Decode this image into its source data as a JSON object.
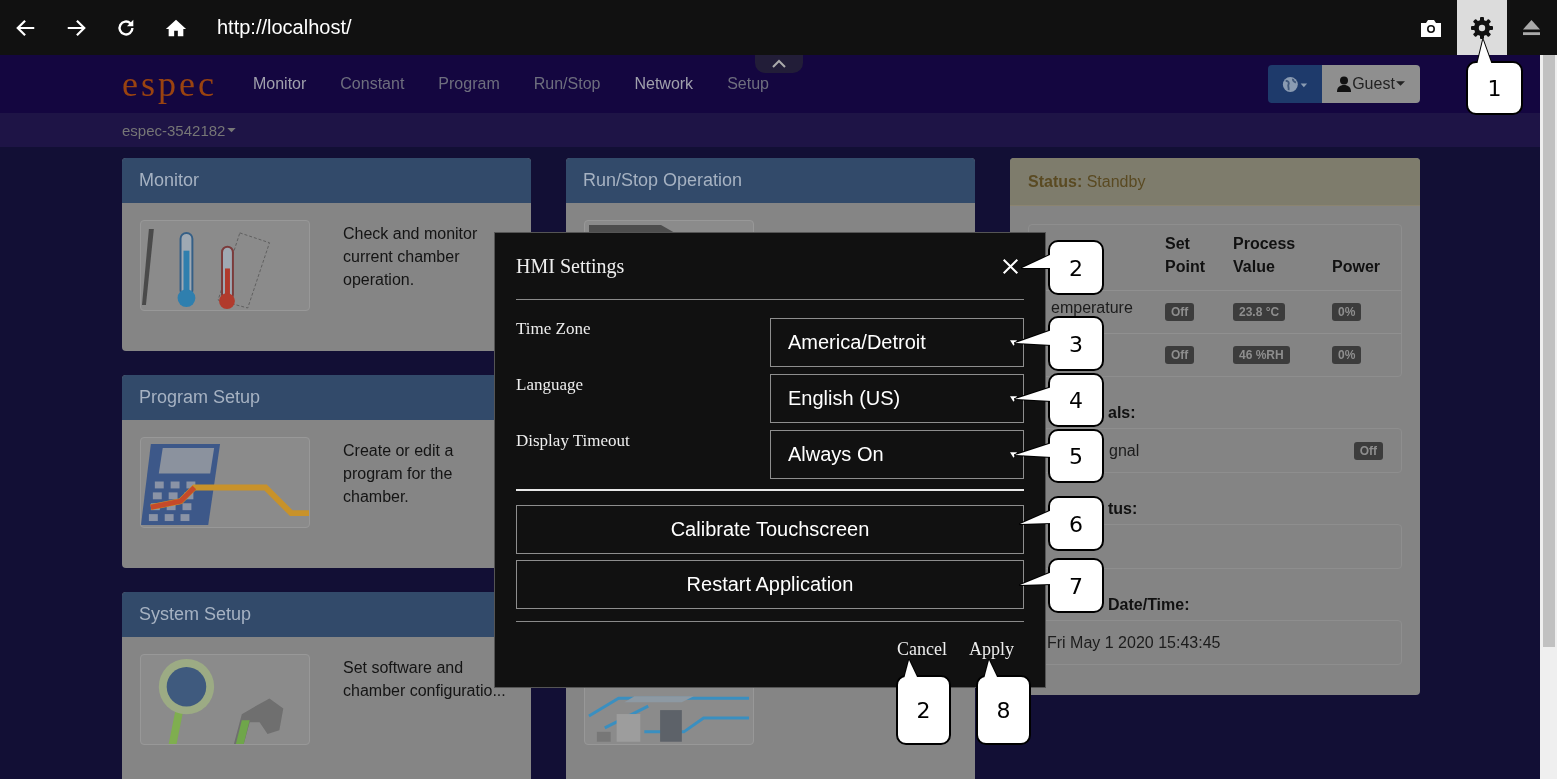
{
  "browser": {
    "url": "http://localhost/",
    "settings_selected": true
  },
  "navbar": {
    "logo": "espec",
    "items": [
      {
        "label": "Monitor",
        "active": true
      },
      {
        "label": "Constant",
        "active": false
      },
      {
        "label": "Program",
        "active": false
      },
      {
        "label": "Run/Stop",
        "active": false
      },
      {
        "label": "Network",
        "active": true
      },
      {
        "label": "Setup",
        "active": false
      }
    ],
    "user": "Guest"
  },
  "device": "espec-3542182",
  "cards": [
    {
      "title": "Monitor",
      "text": "Check and monitor current chamber operation."
    },
    {
      "title": "Program Setup",
      "text": "Create or edit a program for the chamber."
    },
    {
      "title": "System Setup",
      "text": "Set software and chamber configuratio..."
    }
  ],
  "middle_card": {
    "title": "Run/Stop Operation"
  },
  "status_panel": {
    "status": "**Status:** Standby",
    "columns": [
      "Set Point",
      "Process Value",
      "Power"
    ],
    "rows": [
      {
        "name": "emperature",
        "cells": [
          "Off",
          "23.8 °C",
          "0%"
        ]
      },
      {
        "cells": [
          "Off",
          "46 %RH",
          "0%"
        ]
      }
    ],
    "sections": [
      {
        "heading": "als:",
        "item": {
          "name": "gnal",
          "badge": "Off"
        }
      },
      {
        "heading": "tus:"
      },
      {
        "heading": "Date/Time:",
        "value": "Fri May 1 2020 15:43:45"
      }
    ]
  },
  "dialog": {
    "title": "HMI Settings",
    "fields": [
      {
        "label": "Time Zone",
        "value": "America/Detroit"
      },
      {
        "label": "Language",
        "value": "English (US)"
      },
      {
        "label": "Display Timeout",
        "value": "Always On"
      }
    ],
    "actions": [
      "Calibrate Touchscreen",
      "Restart Application"
    ],
    "footer": [
      "Cancel",
      "Apply"
    ]
  },
  "callouts": [
    {
      "label": "1"
    },
    {
      "label": "2"
    },
    {
      "label": "3"
    },
    {
      "label": "4"
    },
    {
      "label": "5"
    },
    {
      "label": "6"
    },
    {
      "label": "7"
    },
    {
      "label": "2"
    },
    {
      "label": "8"
    }
  ]
}
